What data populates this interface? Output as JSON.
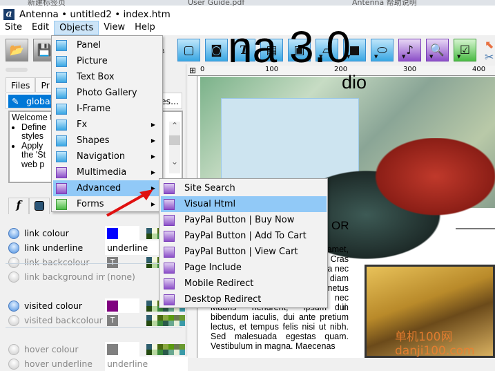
{
  "browser_tabs": [
    "新建标签页",
    "User Guide.pdf",
    "Antenna 帮助说明"
  ],
  "window": {
    "title": "Antenna • untitled2 • index.htm"
  },
  "menubar": [
    "Site",
    "Edit",
    "Objects",
    "View",
    "Help"
  ],
  "left_panel": {
    "tabs": [
      "Files",
      "Pr"
    ],
    "style_selector": {
      "value": "global",
      "right_button": "les..."
    },
    "welcome": {
      "line": "Welcome t",
      "bullets": [
        "Define styles",
        "Apply the 'St web p"
      ]
    },
    "format_tabs": [
      "f",
      ""
    ],
    "properties": [
      {
        "label": "link colour",
        "active": true,
        "value_type": "color",
        "color": "#0000ff"
      },
      {
        "label": "link underline",
        "active": true,
        "value": "underline"
      },
      {
        "label": "link backcolour",
        "active": false,
        "value_type": "transparent",
        "value": "T"
      },
      {
        "label": "link background imag",
        "active": false,
        "value": "(none)"
      },
      {
        "label": "visited colour",
        "active": true,
        "value_type": "color",
        "color": "#800080"
      },
      {
        "label": "visited backcolour",
        "active": false,
        "value_type": "transparent",
        "value": "T"
      },
      {
        "label": "hover colour",
        "active": false,
        "value_type": "color",
        "color": "#808080"
      },
      {
        "label": "hover underline",
        "active": false,
        "value": "underline"
      }
    ],
    "palette": [
      "#2e5e6e",
      "#f4f8e0",
      "#4a6a10",
      "#8aa840",
      "#5a9a10",
      "#6a7a50",
      "#6a9a30",
      "#244a10",
      "#b8d8a0",
      "#3a8a3a",
      "#2a5a4a",
      "#6aa890",
      "#e8f0d8",
      "#3a9aa8"
    ]
  },
  "canvas": {
    "ruler_ticks": [
      "0",
      "100",
      "200",
      "300",
      "400"
    ],
    "banner_title": "na 3.0",
    "banner_sub": "dio",
    "heading": "OR",
    "body_right": [
      "amet,",
      "Cras",
      "a nec",
      "diam",
      "metus",
      "nec",
      "dui."
    ],
    "body_text": "Mauris hendrerit, ipsum in bibendum iaculis, dui ante pretium lectus, et tempus felis nisi ut nibh. Sed malesuada egestas quam. Vestibulum in magna. Maecenas",
    "watermark": "单机100网 danji100.com"
  },
  "objects_menu": [
    {
      "label": "Panel",
      "icon": "panel-icon"
    },
    {
      "label": "Picture",
      "icon": "camera-icon"
    },
    {
      "label": "Text Box",
      "icon": "textbox-icon"
    },
    {
      "label": "Photo Gallery",
      "icon": "gallery-icon"
    },
    {
      "label": "I-Frame",
      "icon": "iframe-icon"
    },
    {
      "label": "Fx",
      "icon": "fx-icon",
      "submenu": true
    },
    {
      "label": "Shapes",
      "icon": "shapes-icon",
      "submenu": true
    },
    {
      "label": "Navigation",
      "icon": "navigation-icon",
      "submenu": true
    },
    {
      "label": "Multimedia",
      "icon": "multimedia-icon",
      "submenu": true
    },
    {
      "label": "Advanced",
      "icon": "magnifier-icon",
      "submenu": true,
      "highlighted": true
    },
    {
      "label": "Forms",
      "icon": "forms-icon",
      "submenu": true
    }
  ],
  "advanced_menu": [
    {
      "label": "Site Search",
      "icon": "magnifier-icon"
    },
    {
      "label": "Visual Html",
      "icon": "eye-icon",
      "highlighted": true
    },
    {
      "label": "PayPal Button | Buy Now",
      "icon": "paypal-buy-icon"
    },
    {
      "label": "PayPal Button | Add To Cart",
      "icon": "paypal-cart-icon"
    },
    {
      "label": "PayPal Button | View Cart",
      "icon": "paypal-view-icon"
    },
    {
      "label": "Page Include",
      "icon": "page-include-icon"
    },
    {
      "label": "Mobile Redirect",
      "icon": "mobile-icon"
    },
    {
      "label": "Desktop Redirect",
      "icon": "desktop-icon"
    }
  ],
  "colors": {
    "menu_highlight": "#91c9f7",
    "accent": "#0078d7"
  }
}
